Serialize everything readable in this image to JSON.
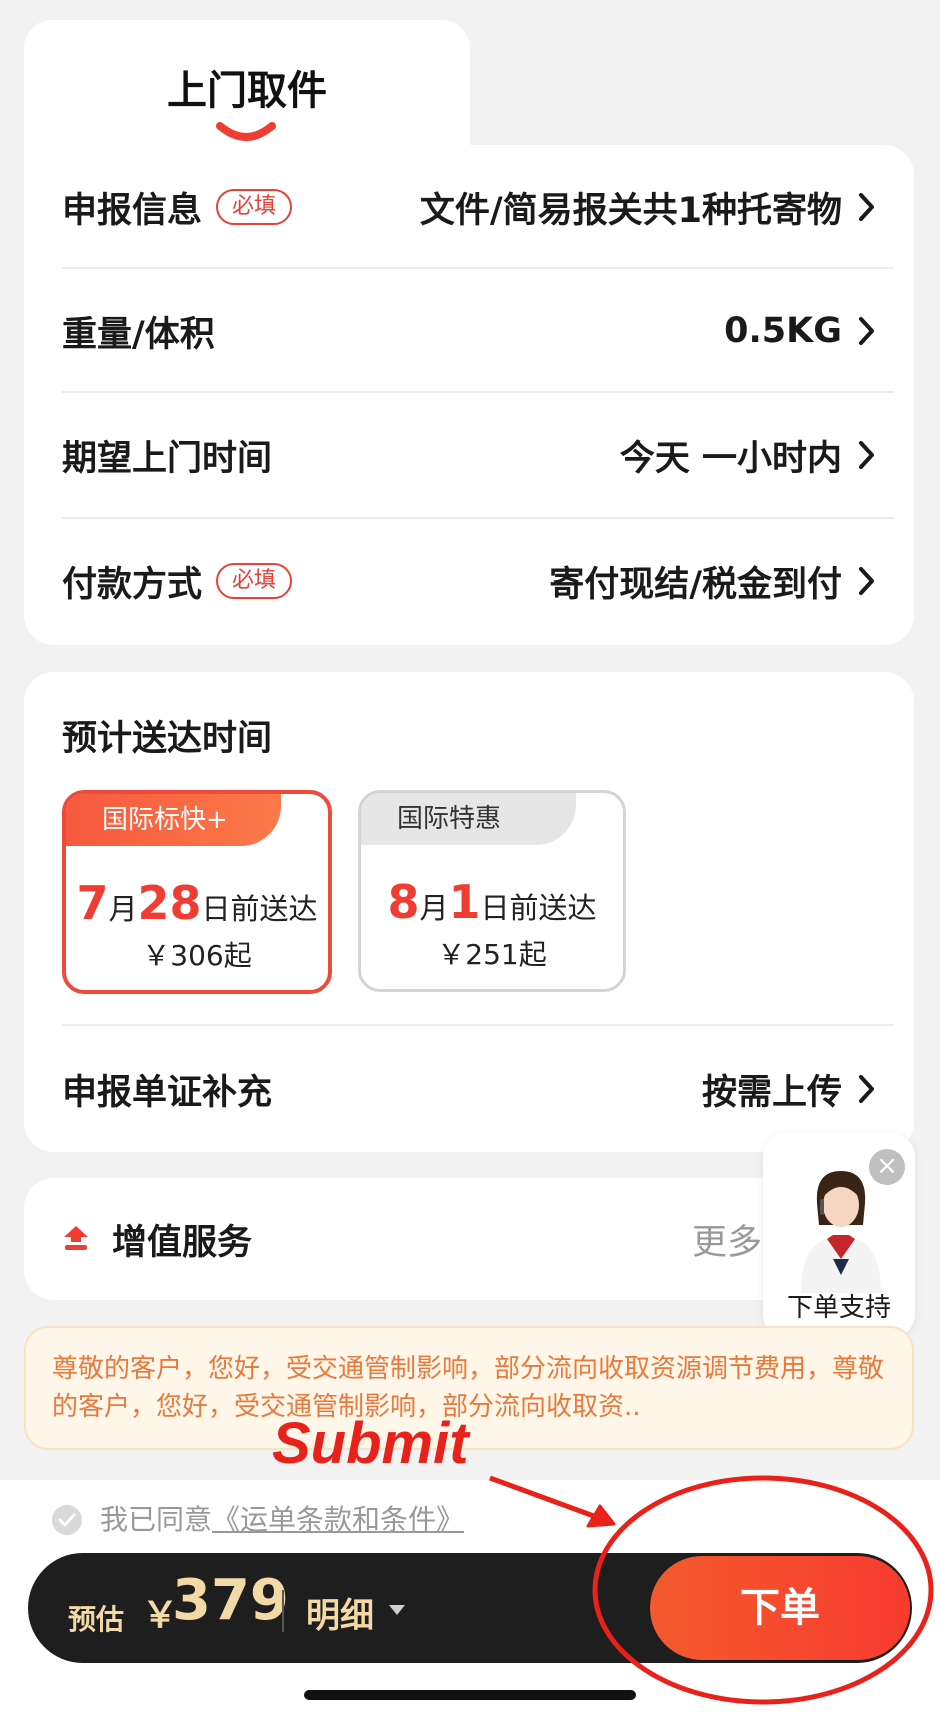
{
  "tab": {
    "title": "上门取件"
  },
  "info": {
    "rows": [
      {
        "label": "申报信息",
        "required": "必填",
        "value": "文件/简易报关共1种托寄物"
      },
      {
        "label": "重量/体积",
        "value": "0.5KG"
      },
      {
        "label": "期望上门时间",
        "value": "今天 一小时内"
      },
      {
        "label": "付款方式",
        "required": "必填",
        "value": "寄付现结/税金到付"
      }
    ]
  },
  "delivery": {
    "title": "预计送达时间",
    "options": [
      {
        "tag": "国际标快+",
        "month": "7",
        "month_unit": "月",
        "day": "28",
        "suffix": "日前送达",
        "price": "￥306起",
        "selected": true
      },
      {
        "tag": "国际特惠",
        "month": "8",
        "month_unit": "月",
        "day": "1",
        "suffix": "日前送达",
        "price": "￥251起",
        "selected": false
      }
    ],
    "docs": {
      "label": "申报单证补充",
      "value": "按需上传"
    }
  },
  "value_added": {
    "label": "增值服务",
    "more": "更多"
  },
  "support": {
    "label": "下单支持"
  },
  "notice": {
    "text": "尊敬的客户，您好，受交通管制影响，部分流向收取资源调节费用，尊敬的客户，您好，受交通管制影响，部分流向收取资.."
  },
  "annotation": {
    "text": "Submit",
    "color": "#e8221b"
  },
  "agreement": {
    "prefix": "我已同意",
    "link": "《运单条款和条件》"
  },
  "footer": {
    "estimate_label": "预估",
    "currency": "￥",
    "price": "379",
    "detail_label": "明细",
    "order_button": "下单"
  },
  "colors": {
    "accent": "#ef3d33",
    "bar": "#1e1e1e",
    "gold": "#f3d9a6",
    "notice_text": "#e77a3c"
  }
}
